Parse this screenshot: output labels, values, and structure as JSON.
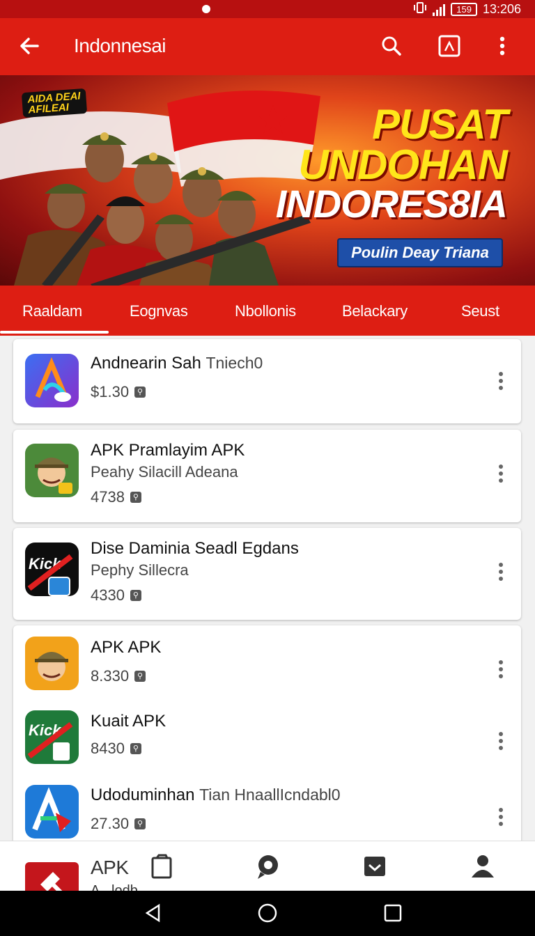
{
  "status_bar": {
    "time": "13:206",
    "battery": "159"
  },
  "app_bar": {
    "title": "Indonnesai",
    "icons": [
      "back-arrow-icon",
      "search-icon",
      "app-icon",
      "more-vert-icon"
    ]
  },
  "banner": {
    "tag_line1": "AIDA DEAI",
    "tag_line2": "AFILEAI",
    "headline_1": "PUSAT",
    "headline_2": "UNDOHAN",
    "headline_3": "INDORES8IA",
    "button": "Poulin Deay Triana"
  },
  "tabs": [
    "Raaldam",
    "Eognvas",
    "Nbollonis",
    "Belackary",
    "Seust"
  ],
  "apps": [
    {
      "name": "Andnearin Sah",
      "name_sub": "Tniech0",
      "developer": "",
      "price": "$1.30"
    },
    {
      "name": "APK Pramlayim APK",
      "name_sub": "",
      "developer": "Peahy Silacill Adeana",
      "price": "4738"
    },
    {
      "name": "Dise Daminia Seadl Egdans",
      "name_sub": "",
      "developer": "Pephy Sillecra",
      "price": "4330"
    },
    {
      "name": "APK APK",
      "name_sub": "",
      "developer": "",
      "price": "8.330"
    },
    {
      "name": "Kuait APK",
      "name_sub": "",
      "developer": "",
      "price": "8430"
    },
    {
      "name": "Udoduminhan",
      "name_sub": "Tian HnaallIcndabl0",
      "developer": "",
      "price": "27.30"
    }
  ],
  "bottom_nav": {
    "label": "APK",
    "sub_label": "A...lodb..."
  },
  "colors": {
    "primary": "#dd1e13",
    "status": "#b71010",
    "accent_yellow": "#ffe61a",
    "pill_blue": "#1e4fa8"
  }
}
